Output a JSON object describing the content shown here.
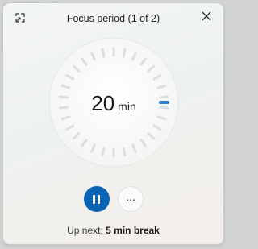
{
  "window": {
    "title": "Focus period (1 of 2)"
  },
  "icons": {
    "compact": "compact-overlay-icon",
    "close": "close-icon",
    "pause": "pause-icon",
    "more": "more-icon"
  },
  "timer": {
    "value": "20",
    "unit": "min",
    "tick_count": 30,
    "progress_fraction": 0.25
  },
  "controls": {
    "more_label": "···"
  },
  "footer": {
    "prefix": "Up next: ",
    "value": "5 min break"
  },
  "colors": {
    "accent": "#0b63b6",
    "progress": "#2f7fd1",
    "tick": "#dcdedd"
  }
}
